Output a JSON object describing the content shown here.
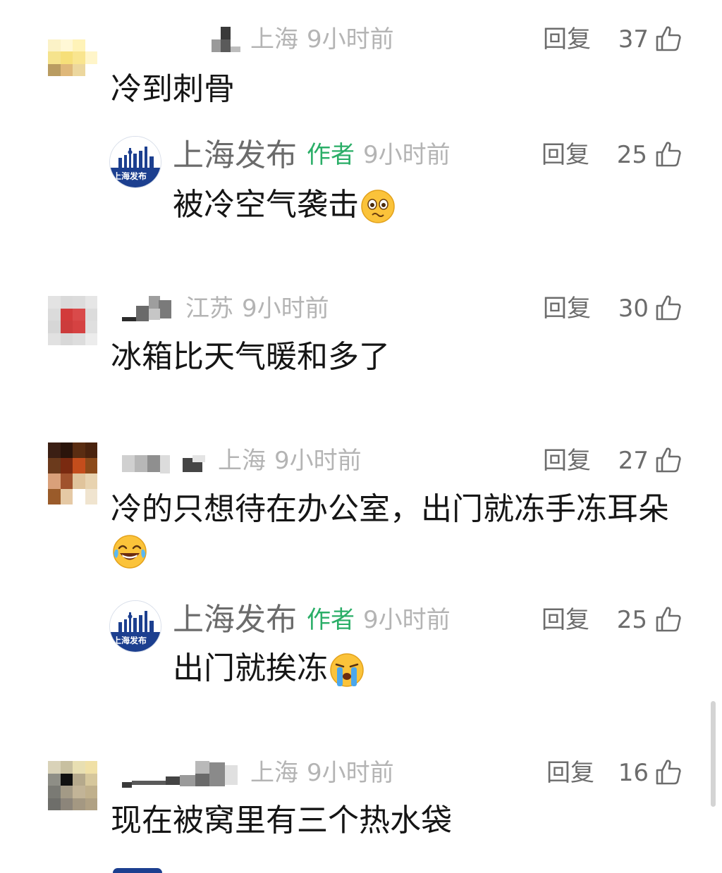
{
  "comments": [
    {
      "location": "上海",
      "time": "9小时前",
      "reply_label": "回复",
      "likes": "37",
      "text": "冷到刺骨"
    },
    {
      "author": "上海发布",
      "badge": "作者",
      "time": "9小时前",
      "reply_label": "回复",
      "likes": "25",
      "text": "被冷空气袭击",
      "emoji": "pleading-face-emoji",
      "avatar_text": "上海发布"
    },
    {
      "location": "江苏",
      "time": "9小时前",
      "reply_label": "回复",
      "likes": "30",
      "text": "冰箱比天气暖和多了"
    },
    {
      "location": "上海",
      "time": "9小时前",
      "reply_label": "回复",
      "likes": "27",
      "text": "冷的只想待在办公室，出门就冻手冻耳朵",
      "emoji": "tears-of-joy-emoji"
    },
    {
      "author": "上海发布",
      "badge": "作者",
      "time": "9小时前",
      "reply_label": "回复",
      "likes": "25",
      "text": "出门就挨冻",
      "emoji": "crying-face-emoji",
      "avatar_text": "上海发布"
    },
    {
      "location": "上海",
      "time": "9小时前",
      "reply_label": "回复",
      "likes": "16",
      "text": "现在被窝里有三个热水袋"
    }
  ],
  "icons": {
    "like": "thumbs-up-icon"
  },
  "colors": {
    "author_badge": "#2aae67",
    "meta_text": "#b4b4b4",
    "official_blue": "#1c3f8f"
  }
}
